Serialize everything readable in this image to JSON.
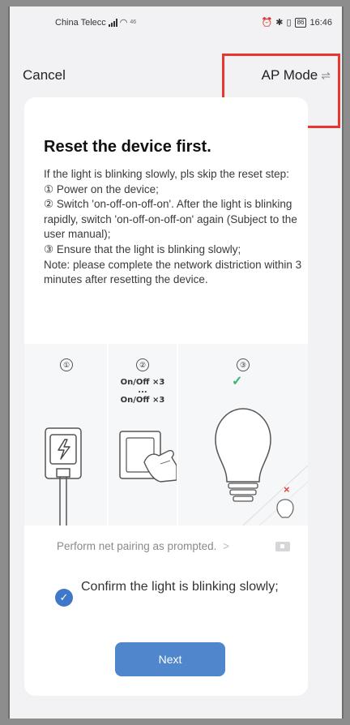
{
  "statusbar": {
    "carrier": "China Telecc",
    "network_tag": "46",
    "battery": "86",
    "time": "16:46"
  },
  "navbar": {
    "cancel_label": "Cancel",
    "ap_mode_label": "AP Mode",
    "ap_mode_icon": "swap-icon",
    "highlight_color": "#e8382d"
  },
  "main": {
    "title": "Reset the device first.",
    "instructions": [
      "If the light is blinking slowly, pls skip the reset step:",
      "① Power on the device;",
      "② Switch 'on-off-on-off-on'. After the light is blinking rapidly, switch 'on-off-on-off-on' again (Subject to the user manual);",
      "③ Ensure that the light is blinking slowly;",
      "Note: please complete the network distriction within 3 minutes after resetting the device."
    ],
    "illustration": {
      "step_numbers": [
        "①",
        "②",
        "③"
      ],
      "onoff_top": "On/Off ×3",
      "onoff_dots": "...",
      "onoff_bottom": "On/Off ×3",
      "check_mark": "✓",
      "x_mark": "×",
      "check_color": "#3cb371",
      "x_color": "#e0453a"
    },
    "pairing_link": "Perform net pairing as prompted.",
    "pairing_chevron": ">",
    "confirm_text": "Confirm the light is blinking slowly;",
    "confirm_checked": true,
    "next_label": "Next",
    "accent_color": "#4f86cc"
  }
}
